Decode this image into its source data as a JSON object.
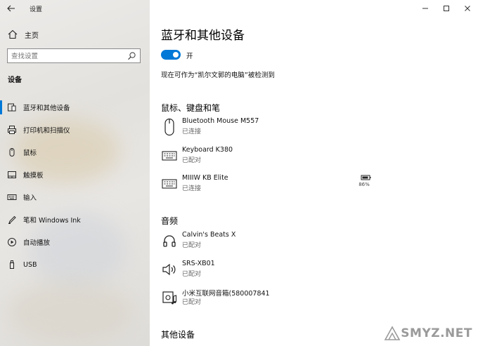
{
  "window": {
    "title": "设置"
  },
  "sidebar": {
    "home_label": "主页",
    "search_placeholder": "查找设置",
    "section_label": "设备",
    "items": [
      {
        "label": "蓝牙和其他设备",
        "icon": "bluetooth-devices-icon",
        "active": true
      },
      {
        "label": "打印机和扫描仪",
        "icon": "printer-icon",
        "active": false
      },
      {
        "label": "鼠标",
        "icon": "mouse-icon",
        "active": false
      },
      {
        "label": "触摸板",
        "icon": "touchpad-icon",
        "active": false
      },
      {
        "label": "输入",
        "icon": "keyboard-icon",
        "active": false
      },
      {
        "label": "笔和 Windows Ink",
        "icon": "pen-icon",
        "active": false
      },
      {
        "label": "自动播放",
        "icon": "autoplay-icon",
        "active": false
      },
      {
        "label": "USB",
        "icon": "usb-icon",
        "active": false
      }
    ]
  },
  "main": {
    "title": "蓝牙和其他设备",
    "toggle_label": "开",
    "toggle_on": true,
    "discoverable_text": "现在可作为“凯尔文郭的电脑”被检测到",
    "sections": {
      "input": {
        "title": "鼠标、键盘和笔",
        "devices": [
          {
            "name": "Bluetooth Mouse M557",
            "status": "已连接",
            "icon": "mouse-icon"
          },
          {
            "name": "Keyboard K380",
            "status": "已配对",
            "icon": "keyboard-icon"
          },
          {
            "name": "MIIIW KB Elite",
            "status": "已连接",
            "icon": "keyboard-icon",
            "battery": "86%"
          }
        ]
      },
      "audio": {
        "title": "音频",
        "devices": [
          {
            "name": "Calvin's Beats X",
            "status": "已配对",
            "icon": "headphones-icon"
          },
          {
            "name": "SRS-XB01",
            "status": "已配对",
            "icon": "speaker-icon"
          },
          {
            "name": "小米互联网音箱(580007841",
            "status": "已配对",
            "icon": "media-speaker-icon"
          }
        ]
      },
      "other": {
        "title": "其他设备"
      }
    }
  },
  "watermark": {
    "text": "SMYZ.NET"
  },
  "colors": {
    "accent": "#0078d7",
    "sidebar_bg": "#e6e4e1",
    "main_bg": "#ffffff"
  }
}
